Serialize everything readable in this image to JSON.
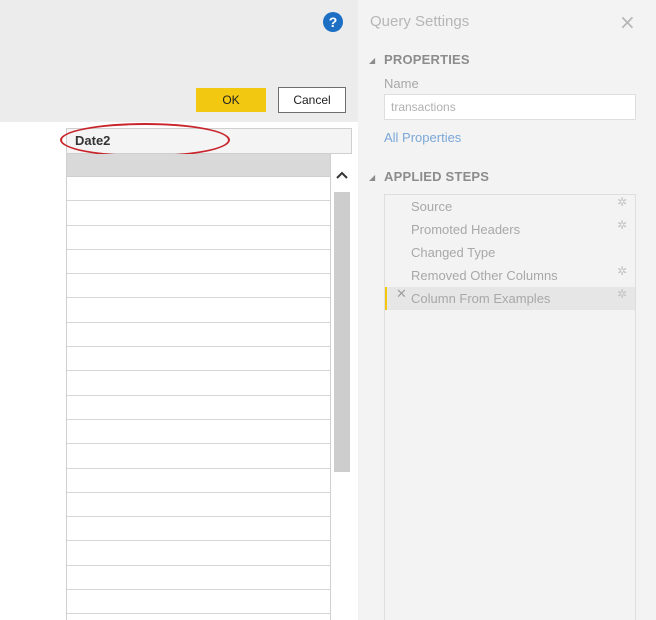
{
  "dialog": {
    "help_icon": "?",
    "ok_label": "OK",
    "cancel_label": "Cancel",
    "column_name": "Date2",
    "scroll_up_glyph": "^"
  },
  "query_settings": {
    "title": "Query Settings",
    "close_glyph": "×",
    "properties_heading": "PROPERTIES",
    "name_label": "Name",
    "name_value": "transactions",
    "all_properties_link": "All Properties",
    "applied_steps_heading": "APPLIED STEPS",
    "steps": [
      {
        "label": "Source",
        "has_gear": true
      },
      {
        "label": "Promoted Headers",
        "has_gear": true
      },
      {
        "label": "Changed Type",
        "has_gear": false
      },
      {
        "label": "Removed Other Columns",
        "has_gear": true
      },
      {
        "label": "Column From Examples",
        "has_gear": true,
        "selected": true
      }
    ]
  },
  "colors": {
    "accent_yellow": "#f2c811",
    "highlight_red": "#c8242b",
    "help_blue": "#1d6fc4",
    "link_blue": "#7aa7d8"
  }
}
